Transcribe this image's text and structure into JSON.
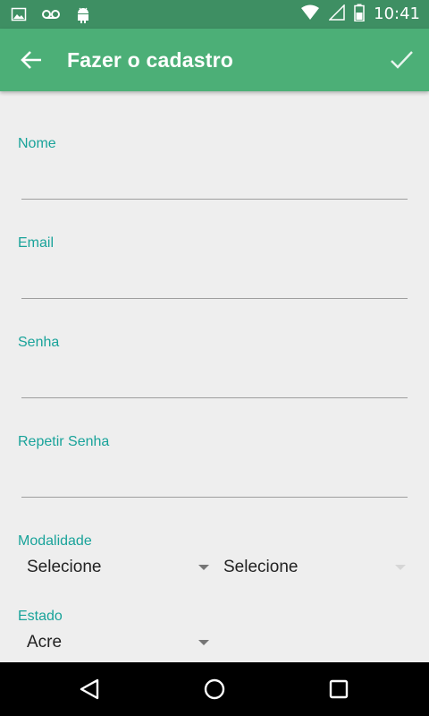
{
  "status_bar": {
    "time": "10:41",
    "left_icons": [
      "image-icon",
      "voicemail-icon",
      "android-icon"
    ],
    "right_icons": [
      "wifi-icon",
      "signal-icon",
      "battery-icon"
    ]
  },
  "app_bar": {
    "title": "Fazer o cadastro",
    "color": "#4caf77"
  },
  "form": {
    "nome_label": "Nome",
    "nome_value": "",
    "email_label": "Email",
    "email_value": "",
    "senha_label": "Senha",
    "senha_value": "",
    "repetir_senha_label": "Repetir Senha",
    "repetir_senha_value": "",
    "modalidade_label": "Modalidade",
    "modalidade_primary": "Selecione",
    "modalidade_secondary": "Selecione",
    "estado_label": "Estado",
    "estado_value": "Acre",
    "accent_color": "#19a39a"
  },
  "nav_bar": {
    "buttons": [
      "back-triangle-icon",
      "home-circle-icon",
      "recents-square-icon"
    ]
  }
}
